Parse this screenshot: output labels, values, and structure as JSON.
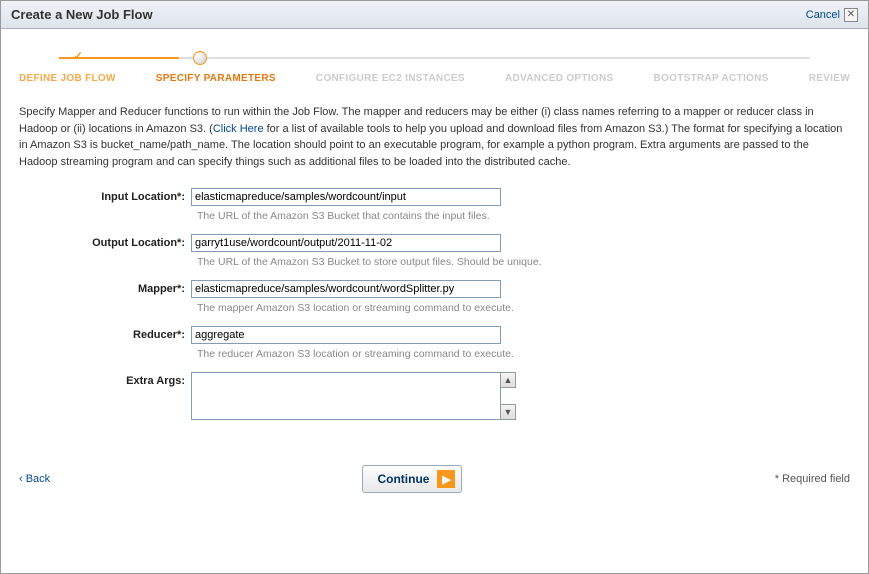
{
  "header": {
    "title": "Create a New Job Flow",
    "cancel": "Cancel"
  },
  "steps": {
    "s1": "DEFINE JOB FLOW",
    "s2": "SPECIFY PARAMETERS",
    "s3": "CONFIGURE EC2 INSTANCES",
    "s4": "ADVANCED OPTIONS",
    "s5": "BOOTSTRAP ACTIONS",
    "s6": "REVIEW"
  },
  "intro": {
    "part1": "Specify Mapper and Reducer functions to run within the Job Flow. The mapper and reducers may be either (i) class names referring to a mapper or reducer class in Hadoop or (ii) locations in Amazon S3. (",
    "link": "Click Here",
    "part2": " for a list of available tools to help you upload and download files from Amazon S3.) The format for specifying a location in Amazon S3 is bucket_name/path_name. The location should point to an executable program, for example a python program. Extra arguments are passed to the Hadoop streaming program and can specify things such as additional files to be loaded into the distributed cache."
  },
  "form": {
    "inputLocation": {
      "label": "Input Location*:",
      "value": "elasticmapreduce/samples/wordcount/input",
      "help": "The URL of the Amazon S3 Bucket that contains the input files."
    },
    "outputLocation": {
      "label": "Output Location*:",
      "value": "garryt1use/wordcount/output/2011-11-02",
      "help": "The URL of the Amazon S3 Bucket to store output files. Should be unique."
    },
    "mapper": {
      "label": "Mapper*:",
      "value": "elasticmapreduce/samples/wordcount/wordSplitter.py",
      "help": "The mapper Amazon S3 location or streaming command to execute."
    },
    "reducer": {
      "label": "Reducer*:",
      "value": "aggregate",
      "help": "The reducer Amazon S3 location or streaming command to execute."
    },
    "extraArgs": {
      "label": "Extra Args:",
      "value": ""
    }
  },
  "footer": {
    "back": "‹ Back",
    "continue": "Continue",
    "required": "* Required field"
  }
}
